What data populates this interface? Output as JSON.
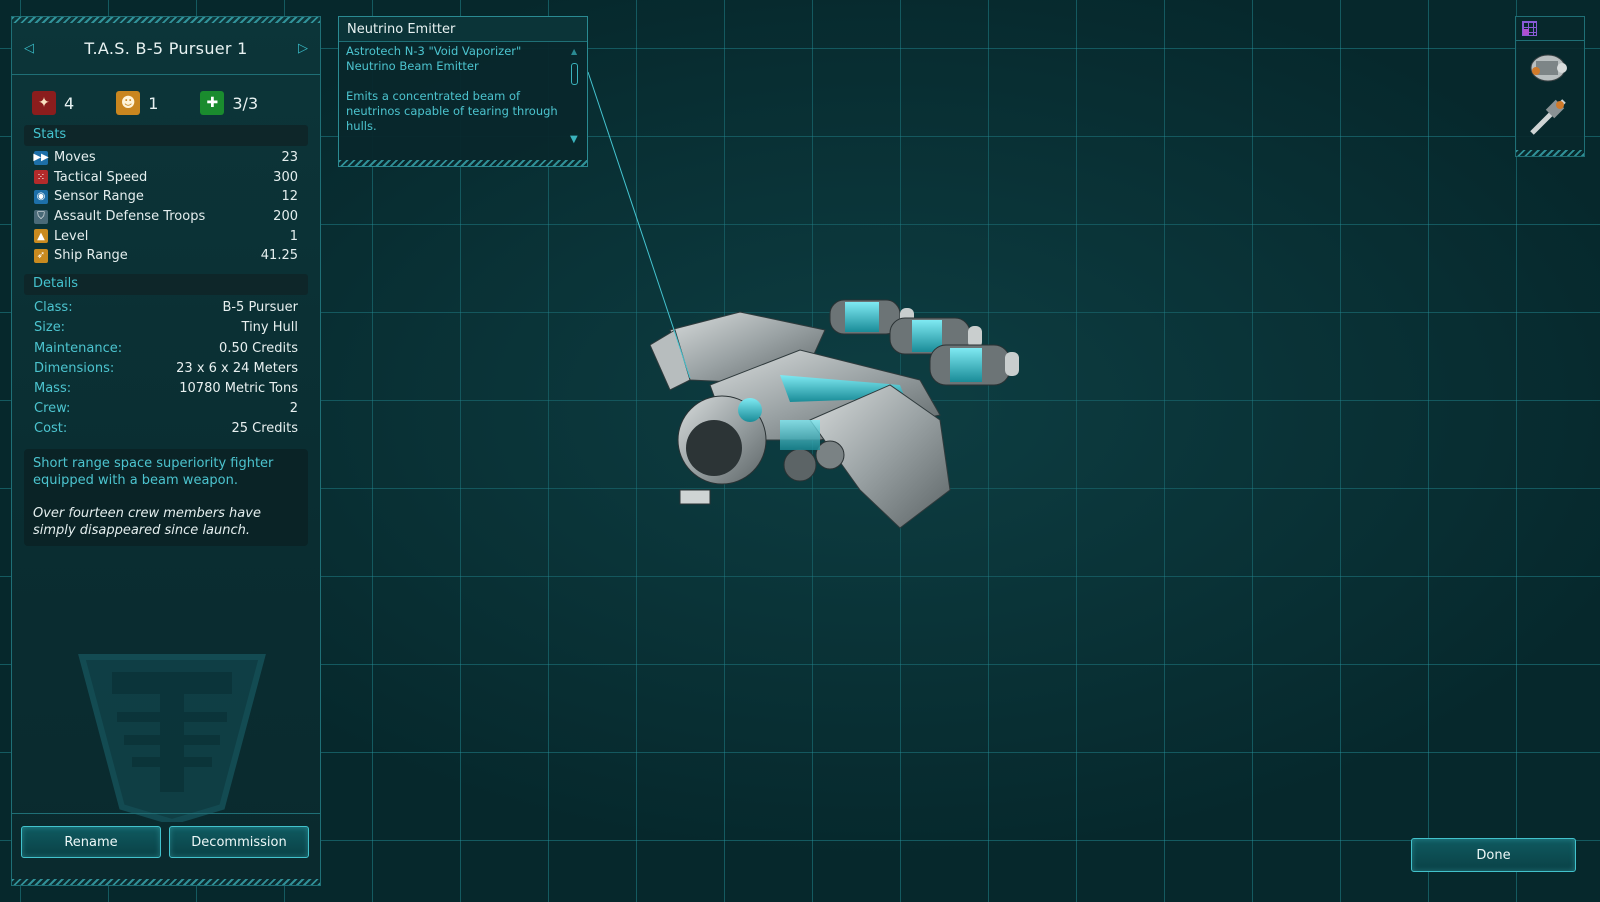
{
  "ship": {
    "name": "T.A.S. B-5 Pursuer 1",
    "counters": {
      "military": "4",
      "crew": "1",
      "health": "3/3"
    }
  },
  "stats": {
    "header": "Stats",
    "items": [
      {
        "label": "Moves",
        "value": "23",
        "icon": "moves-icon",
        "color": "#1d6fa8"
      },
      {
        "label": "Tactical Speed",
        "value": "300",
        "icon": "tactical-speed-icon",
        "color": "#b32b2b"
      },
      {
        "label": "Sensor Range",
        "value": "12",
        "icon": "sensor-icon",
        "color": "#1d6fa8"
      },
      {
        "label": "Assault Defense Troops",
        "value": "200",
        "icon": "shield-icon",
        "color": "#4a6a78"
      },
      {
        "label": "Level",
        "value": "1",
        "icon": "level-icon",
        "color": "#c98a1f"
      },
      {
        "label": "Ship Range",
        "value": "41.25",
        "icon": "range-icon",
        "color": "#c98a1f"
      }
    ]
  },
  "details": {
    "header": "Details",
    "items": [
      {
        "label": "Class:",
        "value": "B-5 Pursuer"
      },
      {
        "label": "Size:",
        "value": "Tiny Hull"
      },
      {
        "label": "Maintenance:",
        "value": "0.50 Credits"
      },
      {
        "label": "Dimensions:",
        "value": "23 x 6 x 24 Meters"
      },
      {
        "label": "Mass:",
        "value": "10780 Metric Tons"
      },
      {
        "label": "Crew:",
        "value": "2"
      },
      {
        "label": "Cost:",
        "value": "25 Credits"
      }
    ]
  },
  "description": {
    "text": "Short range space superiority fighter equipped with a beam weapon.",
    "flavor": "Over fourteen crew members have simply disappeared since launch."
  },
  "buttons": {
    "rename": "Rename",
    "decommission": "Decommission",
    "done": "Done"
  },
  "tooltip": {
    "title": "Neutrino Emitter",
    "line1": "Astrotech N-3 \"Void Vaporizer\"",
    "line2": "Neutrino Beam Emitter",
    "desc": "Emits a concentrated beam of neutrinos capable of tearing through hulls."
  },
  "colors": {
    "accent": "#44c3cf",
    "panel": "#0a2d31",
    "grid": "#2696a0"
  }
}
